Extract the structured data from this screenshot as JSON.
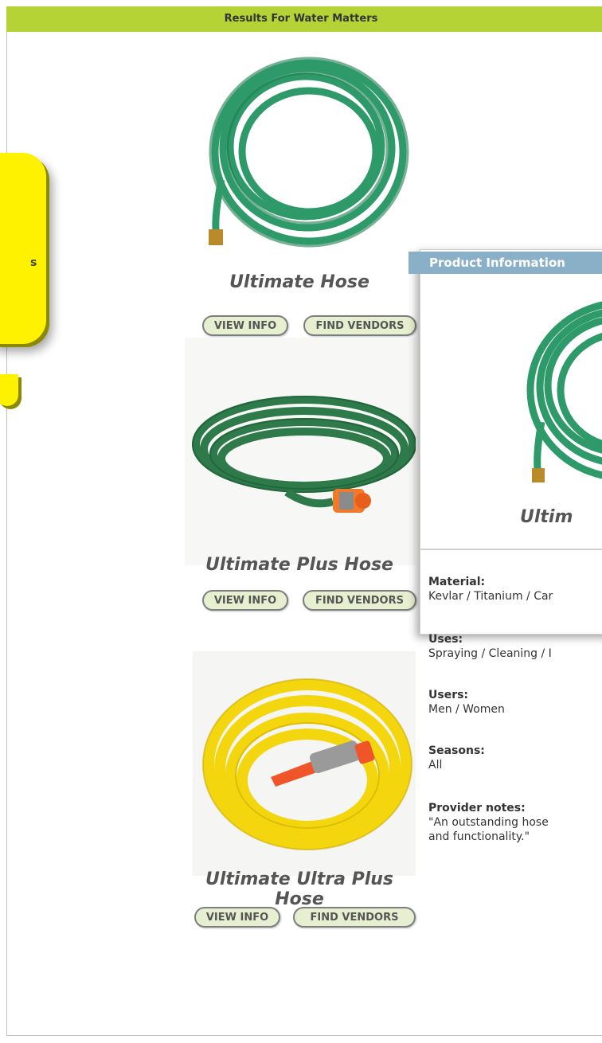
{
  "header": {
    "title": "Results For Water Matters"
  },
  "callout": {
    "glyph": "s"
  },
  "products": [
    {
      "name": "Ultimate Hose",
      "view_label": "VIEW INFO",
      "vendors_label": "FIND VENDORS",
      "color": "#2e9a6a"
    },
    {
      "name": "Ultimate Plus Hose",
      "view_label": "VIEW INFO",
      "vendors_label": "FIND VENDORS",
      "color": "#2f7a4a"
    },
    {
      "name": "Ultimate Ultra Plus Hose",
      "view_label": "VIEW INFO",
      "vendors_label": "FIND VENDORS",
      "color": "#f4d60f"
    }
  ],
  "panel": {
    "title": "Product Information",
    "product_name": "Ultim",
    "specs": [
      {
        "label": "Material:",
        "value": "Kevlar / Titanium / Car"
      },
      {
        "label": "Uses:",
        "value": "Spraying / Cleaning / I"
      },
      {
        "label": "Users:",
        "value": "Men / Women"
      },
      {
        "label": "Seasons:",
        "value": "All"
      },
      {
        "label": "Provider notes:",
        "value": "\"An outstanding hose",
        "value2": "and functionality.\""
      }
    ]
  },
  "colors": {
    "header_bar": "#b5d334",
    "panel_header": "#8ab0c8",
    "button_fill": "#e6efcf",
    "callout": "#fff200"
  }
}
